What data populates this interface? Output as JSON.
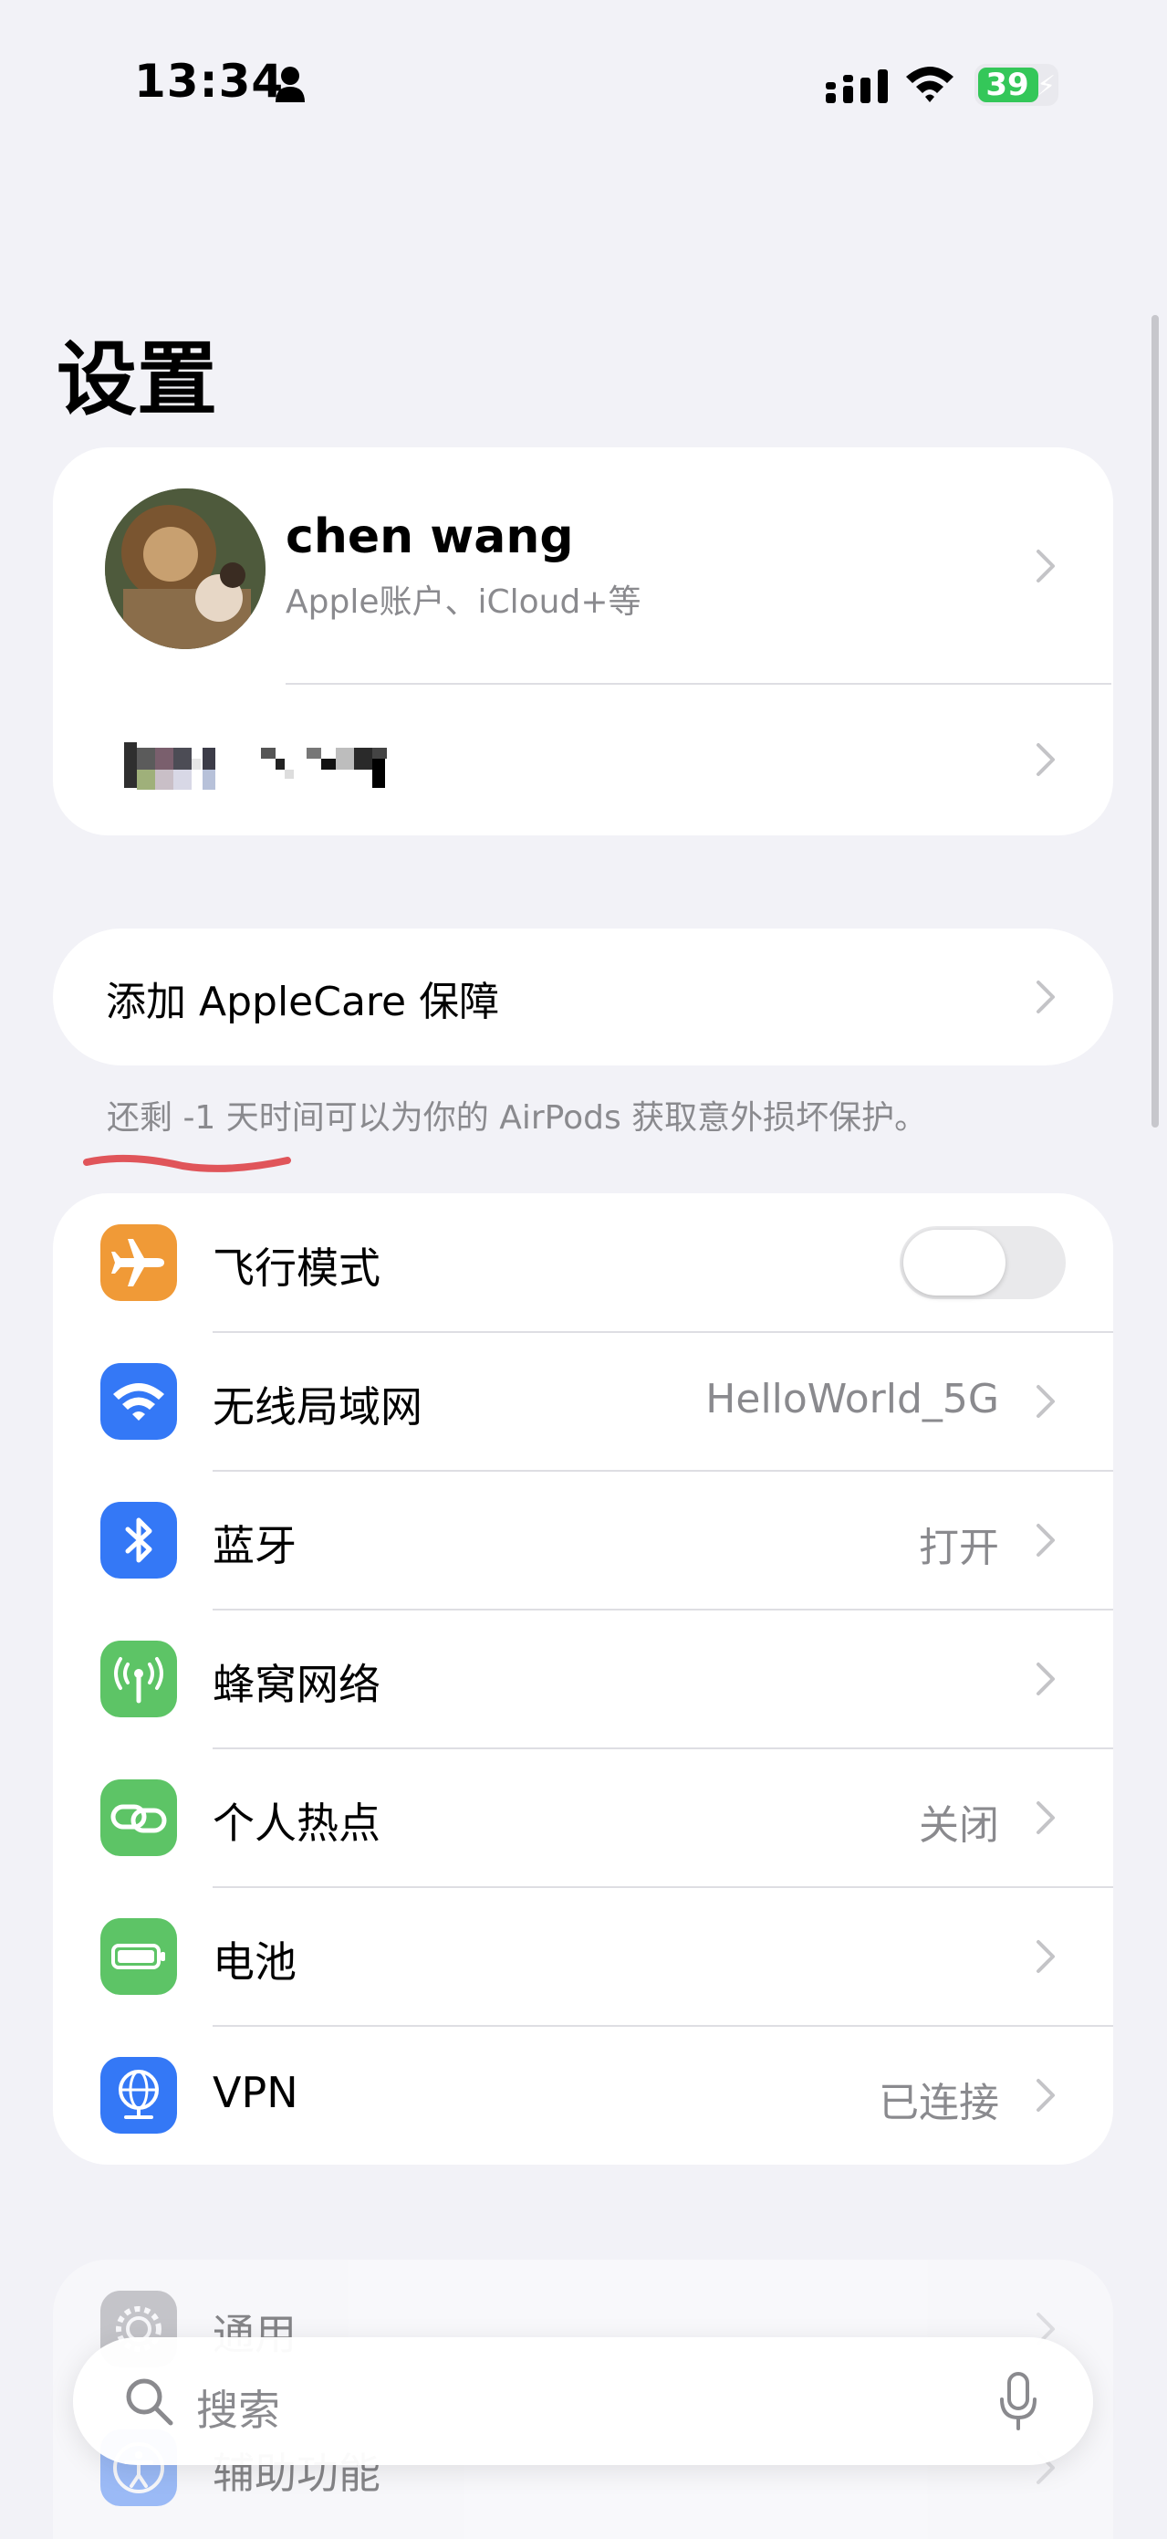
{
  "status_bar": {
    "time": "13:34",
    "battery": "39"
  },
  "page_title": "设置",
  "profile": {
    "name": "chen wang",
    "subtitle": "Apple账户、iCloud+等"
  },
  "applecare": {
    "label": "添加 AppleCare 保障",
    "footnote": "还剩 -1 天时间可以为你的 AirPods 获取意外损坏保护。"
  },
  "connectivity": [
    {
      "label": "飞行模式",
      "value": "",
      "icon": "airplane-icon",
      "color": "#f09a37",
      "toggle": false
    },
    {
      "label": "无线局域网",
      "value": "HelloWorld_5G",
      "icon": "wifi-icon",
      "color": "#3478f6"
    },
    {
      "label": "蓝牙",
      "value": "打开",
      "icon": "bluetooth-icon",
      "color": "#3478f6"
    },
    {
      "label": "蜂窝网络",
      "value": "",
      "icon": "cellular-icon",
      "color": "#5dc466"
    },
    {
      "label": "个人热点",
      "value": "关闭",
      "icon": "hotspot-icon",
      "color": "#5dc466"
    },
    {
      "label": "电池",
      "value": "",
      "icon": "battery-icon",
      "color": "#5dc466"
    },
    {
      "label": "VPN",
      "value": "已连接",
      "icon": "globe-icon",
      "color": "#3478f6"
    }
  ],
  "general": [
    {
      "label": "通用",
      "icon": "gear-icon",
      "color": "#8e8e93"
    },
    {
      "label": "辅助功能",
      "icon": "accessibility-icon",
      "color": "#3478f6"
    }
  ],
  "search": {
    "placeholder": "搜索"
  }
}
